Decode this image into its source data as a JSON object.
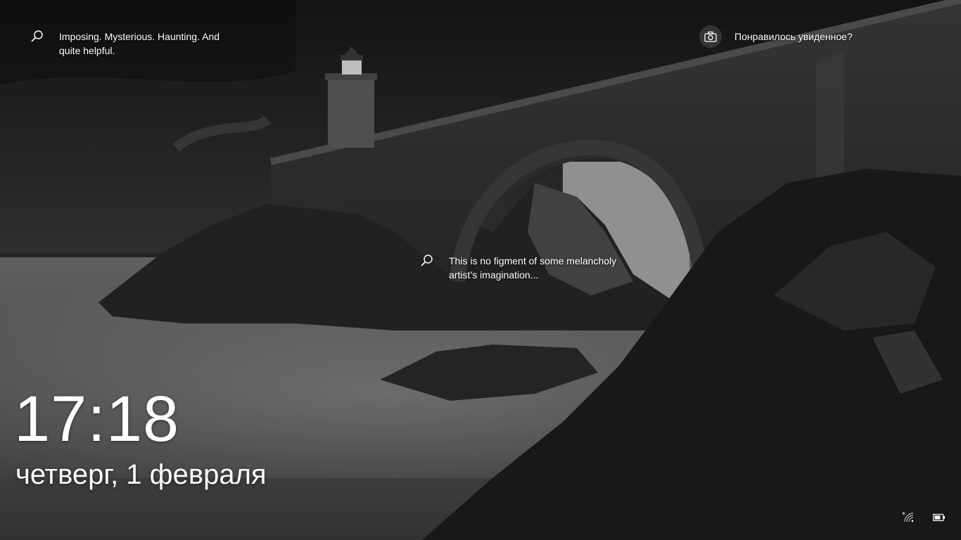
{
  "spotlight": {
    "hotspots": [
      {
        "text": "Imposing. Mysterious. Haunting. And quite helpful."
      },
      {
        "text": "This is no figment of some melancholy artist’s imagination..."
      }
    ],
    "feedback_label": "Понравилось увиденное?"
  },
  "lock": {
    "time": "17:18",
    "date": "четверг, 1 февраля"
  },
  "icons": {
    "hotspot": "search-icon",
    "feedback": "camera-icon",
    "network": "wifi-icon",
    "battery": "battery-icon"
  }
}
